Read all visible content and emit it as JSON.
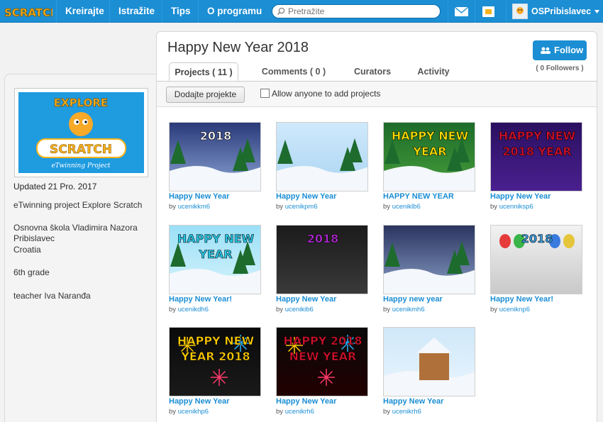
{
  "nav": {
    "logo_text": "SCRATCH",
    "items": [
      "Kreirajte",
      "Istražite",
      "Tips",
      "O programu"
    ],
    "search_placeholder": "Pretražite",
    "username": "OSPribislavec"
  },
  "studio": {
    "title": "Happy New Year 2018",
    "follow_label": "Follow",
    "followers": "( 0 Followers )",
    "tabs": [
      "Projects ( 11 )",
      "Comments ( 0 )",
      "Curators",
      "Activity"
    ],
    "add_button": "Dodajte projekte",
    "allow_label": "Allow anyone to add projects"
  },
  "sidebar": {
    "thumb_top": "EXPLORE",
    "thumb_mid": "SCRATCH",
    "thumb_bottom": "eTwinning Project",
    "updated": "Updated 21 Pro. 2017",
    "lines": [
      "eTwinning project Explore Scratch",
      "Osnovna škola Vladimira Nazora",
      "Pribislavec",
      "Croatia",
      "6th grade",
      "teacher Iva Naranđa"
    ]
  },
  "by_prefix": "by",
  "projects": [
    {
      "title": "Happy New Year",
      "author": "ucenikkm6",
      "overlay": "2018"
    },
    {
      "title": "Happy New Year",
      "author": "ucenikpm6",
      "overlay": ""
    },
    {
      "title": "HAPPY NEW YEAR",
      "author": "uceniklb6",
      "overlay": "HAPPY NEW YEAR"
    },
    {
      "title": "Happy New Year",
      "author": "ucenniksp6",
      "overlay": "HAPPY NEW 2018 YEAR"
    },
    {
      "title": "Happy New Year!",
      "author": "ucenikdh6",
      "overlay": "HAPPY NEW YEAR"
    },
    {
      "title": "Happy New Year",
      "author": "ucenikib6",
      "overlay": "2018"
    },
    {
      "title": "Happy new year",
      "author": "ucenikmh6",
      "overlay": ""
    },
    {
      "title": "Happy New Year!",
      "author": "uceniknp6",
      "overlay": "2018"
    },
    {
      "title": "Happy New Year",
      "author": "ucenikhp6",
      "overlay": "HAPPY NEW YEAR 2018"
    },
    {
      "title": "Happy New Year",
      "author": "ucenikrh6",
      "overlay": "HAPPY 2018 NEW YEAR"
    },
    {
      "title": "Happy New Year",
      "author": "ucenikrh6",
      "overlay": ""
    }
  ]
}
